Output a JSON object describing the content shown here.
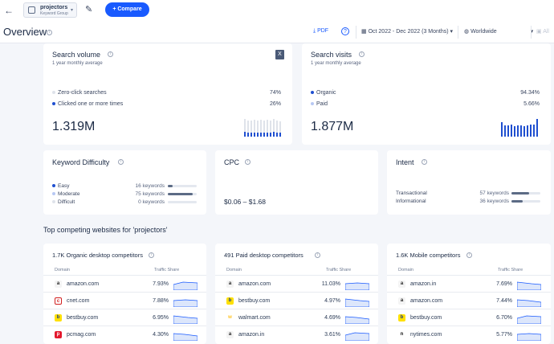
{
  "header": {
    "keyword_group_title": "projectors",
    "keyword_group_sub": "Keyword Group",
    "compare_label": "+ Compare"
  },
  "toolbar": {
    "page_title": "Overview",
    "pdf_label": "PDF",
    "date_range": "Oct 2022 - Dec 2022 (3 Months)",
    "region": "Worldwide",
    "all_label": "All"
  },
  "search_volume": {
    "title": "Search volume",
    "subtitle": "1 year monthly average",
    "rows": [
      {
        "label": "Zero-click searches",
        "value": "74%"
      },
      {
        "label": "Clicked one or more times",
        "value": "26%"
      }
    ],
    "total": "1.319M"
  },
  "search_visits": {
    "title": "Search visits",
    "subtitle": "1 year monthly average",
    "rows": [
      {
        "label": "Organic",
        "value": "94.34%"
      },
      {
        "label": "Paid",
        "value": "5.66%"
      }
    ],
    "total": "1.877M"
  },
  "keyword_difficulty": {
    "title": "Keyword Difficulty",
    "rows": [
      {
        "label": "Easy",
        "count": "16 keywords",
        "share": 0.18
      },
      {
        "label": "Moderate",
        "count": "75 keywords",
        "share": 0.85
      },
      {
        "label": "Difficult",
        "count": "0 keywords",
        "share": 0
      }
    ]
  },
  "cpc": {
    "title": "CPC",
    "value": "$0.06 – $1.68"
  },
  "intent": {
    "title": "Intent",
    "rows": [
      {
        "label": "Transactional",
        "count": "57 keywords",
        "share": 0.6
      },
      {
        "label": "Informational",
        "count": "36 keywords",
        "share": 0.38
      }
    ]
  },
  "competitors": {
    "section_title": "Top competing websites for 'projectors'",
    "domain_header": "Domain",
    "share_header": "Traffic Share",
    "cards": [
      {
        "title": "1.7K Organic desktop competitors",
        "rows": [
          {
            "domain": "amazon.com",
            "share": "7.93%",
            "icon": "a"
          },
          {
            "domain": "cnet.com",
            "share": "7.88%",
            "icon": "c"
          },
          {
            "domain": "bestbuy.com",
            "share": "6.95%",
            "icon": "b"
          },
          {
            "domain": "pcmag.com",
            "share": "4.30%",
            "icon": "p"
          }
        ]
      },
      {
        "title": "491 Paid desktop competitors",
        "rows": [
          {
            "domain": "amazon.com",
            "share": "11.03%",
            "icon": "a"
          },
          {
            "domain": "bestbuy.com",
            "share": "4.97%",
            "icon": "b"
          },
          {
            "domain": "walmart.com",
            "share": "4.69%",
            "icon": "w"
          },
          {
            "domain": "amazon.in",
            "share": "3.61%",
            "icon": "a"
          }
        ]
      },
      {
        "title": "1.6K Mobile competitors",
        "rows": [
          {
            "domain": "amazon.in",
            "share": "7.69%",
            "icon": "a"
          },
          {
            "domain": "amazon.com",
            "share": "7.44%",
            "icon": "a"
          },
          {
            "domain": "bestbuy.com",
            "share": "6.70%",
            "icon": "b"
          },
          {
            "domain": "nytimes.com",
            "share": "5.77%",
            "icon": "n"
          }
        ]
      }
    ]
  },
  "colors": {
    "accent": "#195afe",
    "dark_blue": "#1f4fd0",
    "light_blue": "#b7c8f3"
  }
}
